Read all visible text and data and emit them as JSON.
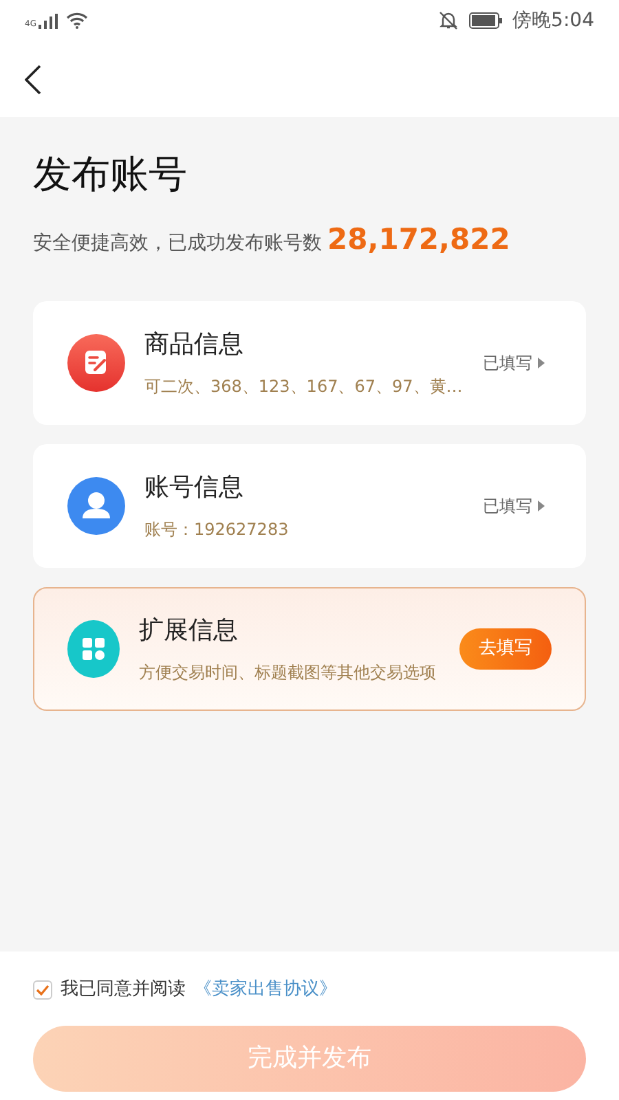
{
  "status_bar": {
    "network": "4G",
    "time": "傍晚5:04"
  },
  "page": {
    "title": "发布账号",
    "subtitle": "安全便捷高效，已成功发布账号数",
    "count": "28,172,822"
  },
  "sections": [
    {
      "kind": "status",
      "title": "商品信息",
      "detail": "可二次、368、123、167、67、97、黄…",
      "action": "已填写",
      "highlighted": false
    },
    {
      "kind": "status",
      "title": "账号信息",
      "detail": "账号：192627283",
      "action": "已填写",
      "highlighted": false
    },
    {
      "kind": "button",
      "title": "扩展信息",
      "detail": "方便交易时间、标题截图等其他交易选项",
      "action": "去填写",
      "highlighted": true
    }
  ],
  "agreement": {
    "checked": true,
    "text": "我已同意并阅读",
    "link": "《卖家出售协议》"
  },
  "submit": {
    "label": "完成并发布",
    "disabled": true
  }
}
